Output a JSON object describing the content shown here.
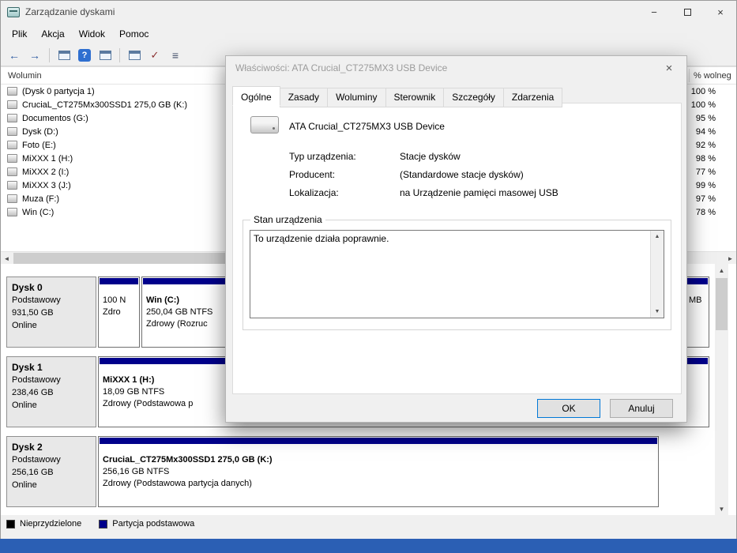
{
  "window": {
    "title": "Zarządzanie dyskami",
    "menu": {
      "items": [
        {
          "label": "Plik"
        },
        {
          "label": "Akcja"
        },
        {
          "label": "Widok"
        },
        {
          "label": "Pomoc"
        }
      ]
    }
  },
  "icons": {
    "minimize": "−",
    "close": "×",
    "back": "←",
    "forward": "→",
    "help": "?",
    "check": "✓",
    "list": "≡",
    "left": "◄",
    "right": "►",
    "up": "▲",
    "down": "▼"
  },
  "colors": {
    "partition_primary": "#00008b",
    "unallocated": "#000000",
    "taskbar": "#2b5fb4"
  },
  "volume_list": {
    "col_volume": "Wolumin",
    "col_free": "% wolneg",
    "rows": [
      {
        "name": "(Dysk 0 partycja 1)",
        "free": "100 %"
      },
      {
        "name": "CruciaL_CT275Mx300SSD1 275,0 GB (K:)",
        "free": "100 %"
      },
      {
        "name": "Documentos (G:)",
        "free": "95 %"
      },
      {
        "name": "Dysk (D:)",
        "free": "94 %"
      },
      {
        "name": "Foto (E:)",
        "free": "92 %"
      },
      {
        "name": "MiXXX 1 (H:)",
        "free": "98 %"
      },
      {
        "name": "MiXXX 2 (I:)",
        "free": "77 %"
      },
      {
        "name": "MiXXX 3 (J:)",
        "free": "99 %"
      },
      {
        "name": "Muza (F:)",
        "free": "97 %"
      },
      {
        "name": "Win (C:)",
        "free": "78 %"
      }
    ]
  },
  "disks": [
    {
      "name": "Dysk 0",
      "type": "Podstawowy",
      "size": "931,50 GB",
      "status": "Online",
      "partitions": [
        {
          "l1": "",
          "l2": "100 N",
          "l3": "Zdro"
        },
        {
          "l1": "Win (C:)",
          "l2": "250,04 GB NTFS",
          "l3": "Zdrowy (Rozruc"
        },
        {
          "l1": "",
          "l2": "MB",
          "l3": ""
        }
      ]
    },
    {
      "name": "Dysk 1",
      "type": "Podstawowy",
      "size": "238,46 GB",
      "status": "Online",
      "partitions": [
        {
          "l1": "MiXXX 1  (H:)",
          "l2": "18,09 GB NTFS",
          "l3": "Zdrowy (Podstawowa p"
        }
      ]
    },
    {
      "name": "Dysk 2",
      "type": "Podstawowy",
      "size": "256,16 GB",
      "status": "Online",
      "partitions": [
        {
          "l1": "CruciaL_CT275Mx300SSD1 275,0 GB  (K:)",
          "l2": "256,16 GB NTFS",
          "l3": "Zdrowy (Podstawowa partycja danych)"
        }
      ]
    }
  ],
  "legend": {
    "unallocated": "Nieprzydzielone",
    "primary": "Partycja podstawowa"
  },
  "dialog": {
    "title": "Właściwości: ATA Crucial_CT275MX3 USB Device",
    "tabs": [
      {
        "label": "Ogólne"
      },
      {
        "label": "Zasady"
      },
      {
        "label": "Woluminy"
      },
      {
        "label": "Sterownik"
      },
      {
        "label": "Szczegóły"
      },
      {
        "label": "Zdarzenia"
      }
    ],
    "device_name": "ATA Crucial_CT275MX3 USB Device",
    "fields": [
      {
        "label": "Typ urządzenia:",
        "value": "Stacje dysków"
      },
      {
        "label": "Producent:",
        "value": "(Standardowe stacje dysków)"
      },
      {
        "label": "Lokalizacja:",
        "value": "na Urządzenie pamięci masowej USB"
      }
    ],
    "status_group_label": "Stan urządzenia",
    "status_text": "To urządzenie działa poprawnie.",
    "ok_label": "OK",
    "cancel_label": "Anuluj"
  }
}
